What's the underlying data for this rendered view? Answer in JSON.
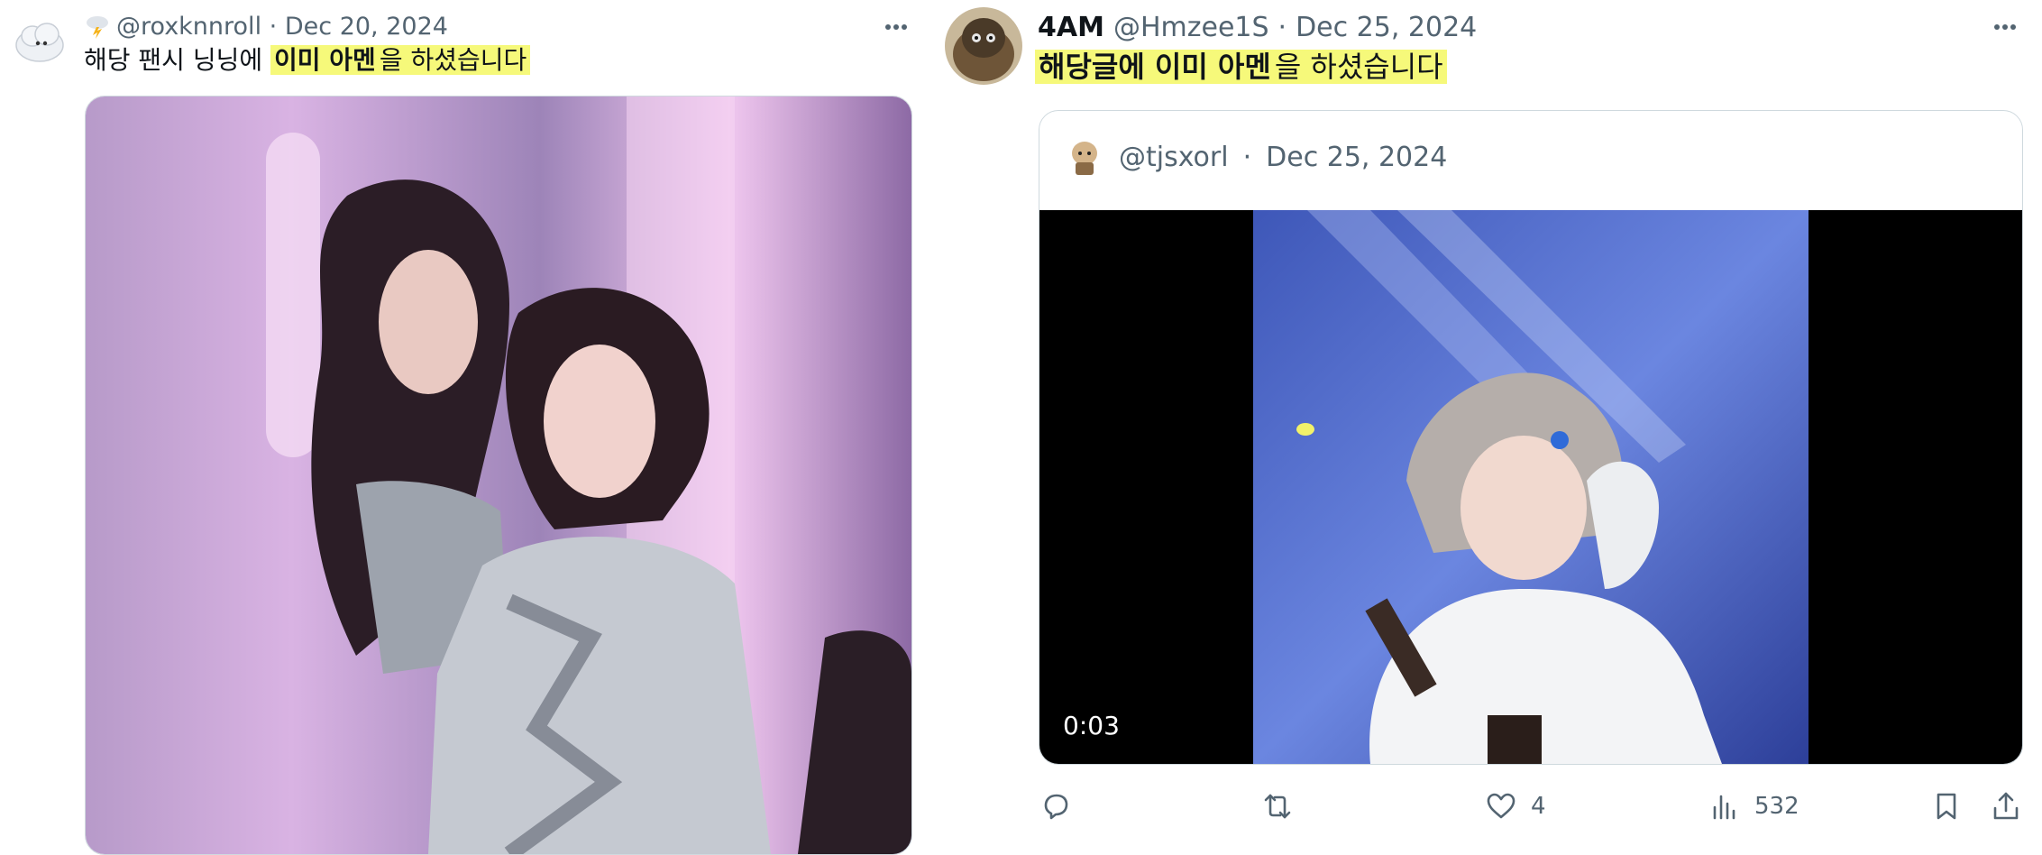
{
  "left_tweet": {
    "handle": "@roxknnroll",
    "separator": "·",
    "date": "Dec 20, 2024",
    "text_plain": "해당 팬시 닝닝에 ",
    "text_highlight": "이미 아멘",
    "text_after": "을 하셨습니다",
    "more_label": "···"
  },
  "right_tweet": {
    "name": "4AM",
    "handle": "@Hmzee1S",
    "separator": "·",
    "date": "Dec 25, 2024",
    "text_highlight_1": "해당글에 이미 아멘",
    "text_after": "을 하셨습니다",
    "more_label": "···",
    "quote": {
      "handle": "@tjsxorl",
      "separator": "·",
      "date": "Dec 25, 2024",
      "video_time": "0:03"
    },
    "actions": {
      "reply_count": "",
      "retweet_count": "",
      "like_count": "4",
      "views_count": "532"
    }
  },
  "colors": {
    "highlight": "#f6f97a",
    "grey_text": "#536471",
    "border": "#cfd9de"
  },
  "icons": [
    "more-icon",
    "reply-icon",
    "retweet-icon",
    "like-icon",
    "views-icon",
    "bookmark-icon",
    "share-icon"
  ]
}
